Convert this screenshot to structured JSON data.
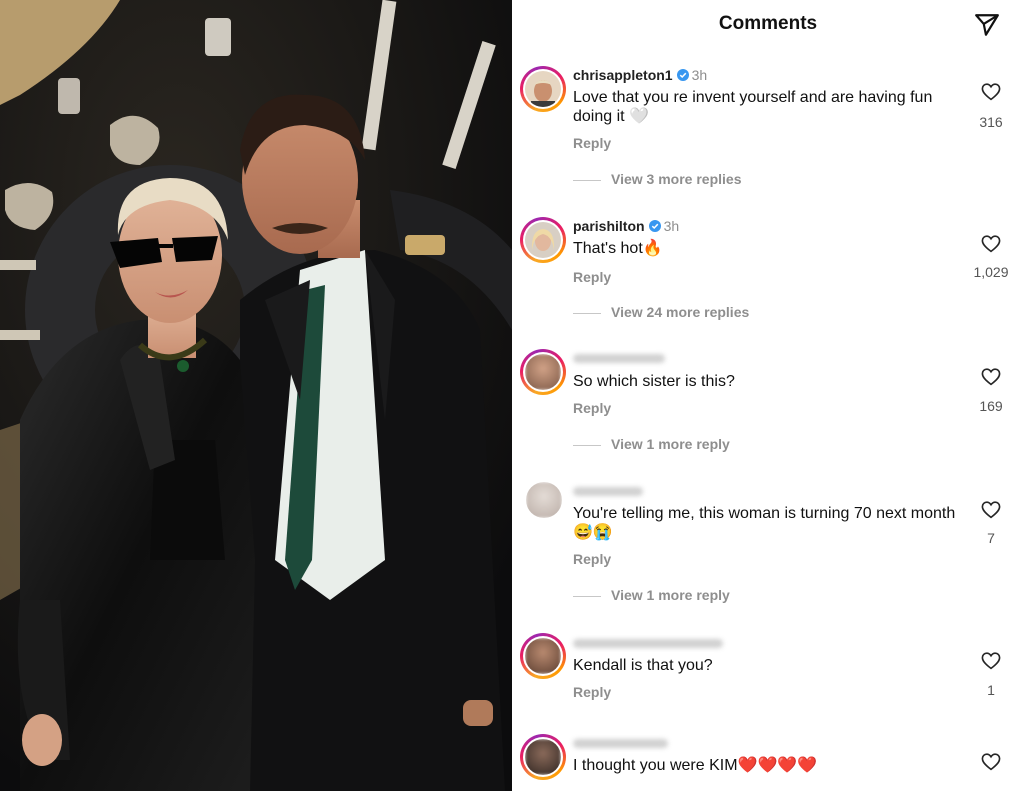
{
  "header": {
    "title": "Comments",
    "send_icon": "paper-plane-icon"
  },
  "photo": {
    "description_icon": "photo"
  },
  "comments": [
    {
      "username": "chrisappleton1",
      "verified": true,
      "time": "3h",
      "text": "Love that you re invent yourself and are having fun doing it 🤍",
      "reply_label": "Reply",
      "view_more": "View 3 more replies",
      "likes": "316"
    },
    {
      "username": "parishilton",
      "verified": true,
      "time": "3h",
      "text": "That's hot🔥",
      "reply_label": "Reply",
      "view_more": "View 24 more replies",
      "likes": "1,029"
    },
    {
      "username": "",
      "verified": false,
      "time": "",
      "text": "So which sister is this?",
      "reply_label": "Reply",
      "view_more": "View 1 more reply",
      "likes": "169"
    },
    {
      "username": "",
      "verified": false,
      "time": "",
      "text": "You're telling me, this woman is turning 70 next month 😅😭",
      "reply_label": "Reply",
      "view_more": "View 1 more reply",
      "likes": "7"
    },
    {
      "username": "",
      "verified": false,
      "time": "",
      "text": "Kendall is that you?",
      "reply_label": "Reply",
      "view_more": "",
      "likes": "1"
    },
    {
      "username": "",
      "verified": false,
      "time": "",
      "text": "I thought you were KIM❤️❤️❤️❤️",
      "reply_label": "",
      "view_more": "",
      "likes": ""
    }
  ],
  "colors": {
    "verified": "#3897f0",
    "secondary_text": "#8e8e8e",
    "ring_start": "#f9a825",
    "ring_end": "#c13584"
  }
}
